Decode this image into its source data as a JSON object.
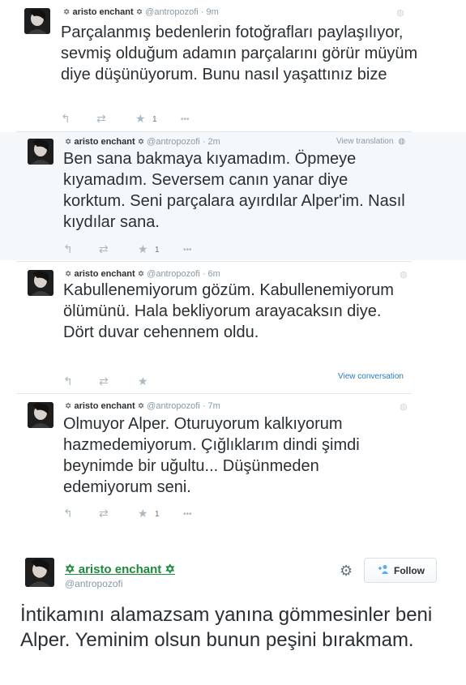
{
  "tweets": [
    {
      "display_name": "aristo enchant",
      "handle": "@antropozofi",
      "sep": "·",
      "time": "9m",
      "text": "Parçalanmış bedenlerin fotoğrafları paylaşılıyor, sevmiş olduğum adamın parçalarını görür müyüm diye düşünüyorum. Bunu nasıl yaşattınız bize",
      "favorite_count": "1",
      "side_link": ""
    },
    {
      "display_name": "aristo enchant",
      "handle": "@antropozofi",
      "sep": "·",
      "time": "2m",
      "text": "Ben sana bakmaya kıyamadım. Öpmeye kıyamadım. Seversem canın yanar diye korktum. Seni parçalara ayırdılar Alper'im. Nasıl kıydılar sana.",
      "favorite_count": "1",
      "side_link": "View translation"
    },
    {
      "display_name": "aristo enchant",
      "handle": "@antropozofi",
      "sep": "·",
      "time": "6m",
      "text": "Kabullenemiyorum gözüm. Kabullenemiyorum ölümünü. Hala bekliyorum arayacaksın diye. Dört duvar cehennem oldu.",
      "favorite_count": "",
      "side_link": "View conversation"
    },
    {
      "display_name": "aristo enchant",
      "handle": "@antropozofi",
      "sep": "·",
      "time": "7m",
      "text": "Olmuyor Alper. Oturuyorum kalkıyorum hazmedemiyorum. Çığlıklarım dindi şimdi beynimde bir uğultu... Düşünmeden edemiyorum seni.",
      "favorite_count": "1",
      "side_link": ""
    }
  ],
  "card": {
    "display_name": "aristo enchant",
    "handle": "@antropozofi",
    "follow_label": "Follow",
    "text": "İntikamını alamazsam yanına gömmesinler beni Alper. Yeminim olsun bunun peşini bırakmam."
  },
  "icons": {
    "name_decoration": "✡",
    "reply": "↰",
    "retweet": "⇄",
    "favorite": "★",
    "more": "•••",
    "globe": "◍",
    "gear": "⚙",
    "add_user": "+👤"
  },
  "colors": {
    "link_blue": "#2b7bb9",
    "card_name_green": "#1b8a3c",
    "highlight_bg": "#f5f8fa"
  }
}
